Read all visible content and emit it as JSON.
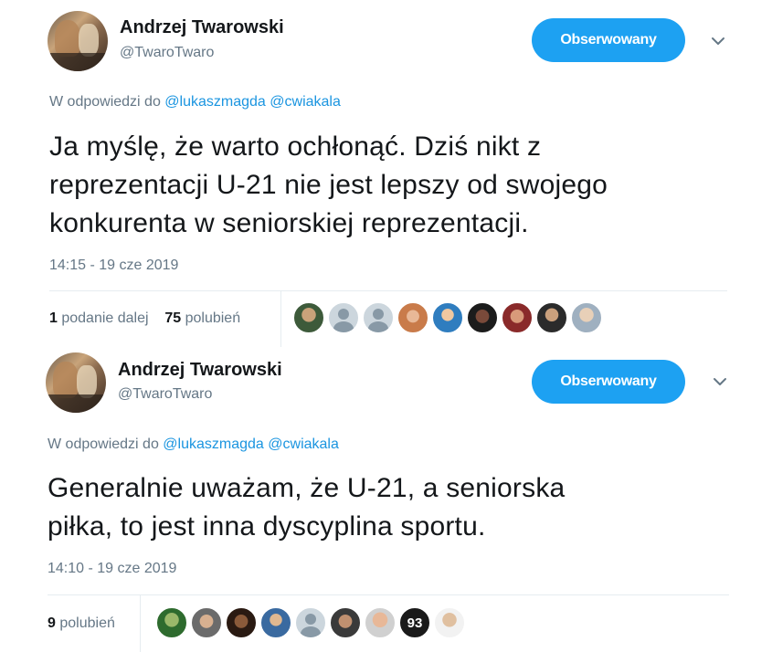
{
  "tweets": [
    {
      "author_name": "Andrzej Twarowski",
      "author_handle": "@TwaroTwaro",
      "follow_label": "Obserwowany",
      "reply_prefix": "W odpowiedzi do",
      "reply_mentions": [
        "@lukaszmagda",
        "@cwiakala"
      ],
      "text_lines": [
        "Ja myślę, że warto ochłonąć. Dziś nikt z",
        "reprezentacji U-21 nie jest lepszy od swojego",
        "konkurenta w seniorskiej reprezentacji."
      ],
      "timestamp": "14:15 - 19 cze 2019",
      "retweets_count": "1",
      "retweets_label": "podanie dalej",
      "likes_count": "75",
      "likes_label": "polubień"
    },
    {
      "author_name": "Andrzej Twarowski",
      "author_handle": "@TwaroTwaro",
      "follow_label": "Obserwowany",
      "reply_prefix": "W odpowiedzi do",
      "reply_mentions": [
        "@lukaszmagda",
        "@cwiakala"
      ],
      "text_lines": [
        "Generalnie uważam, że U-21, a seniorska",
        "piłka, to jest inna dyscyplina sportu."
      ],
      "timestamp": "14:10 - 19 cze 2019",
      "likes_count": "9",
      "likes_label": "polubień",
      "liker_number_badge": "93"
    }
  ],
  "colors": {
    "accent": "#1da1f2",
    "mention": "#1b95e0",
    "muted": "#657786",
    "text": "#14171a",
    "divider": "#e6ecf0"
  },
  "icons": {
    "more": "chevron-down-icon",
    "default_avatar": "default-profile-icon"
  }
}
